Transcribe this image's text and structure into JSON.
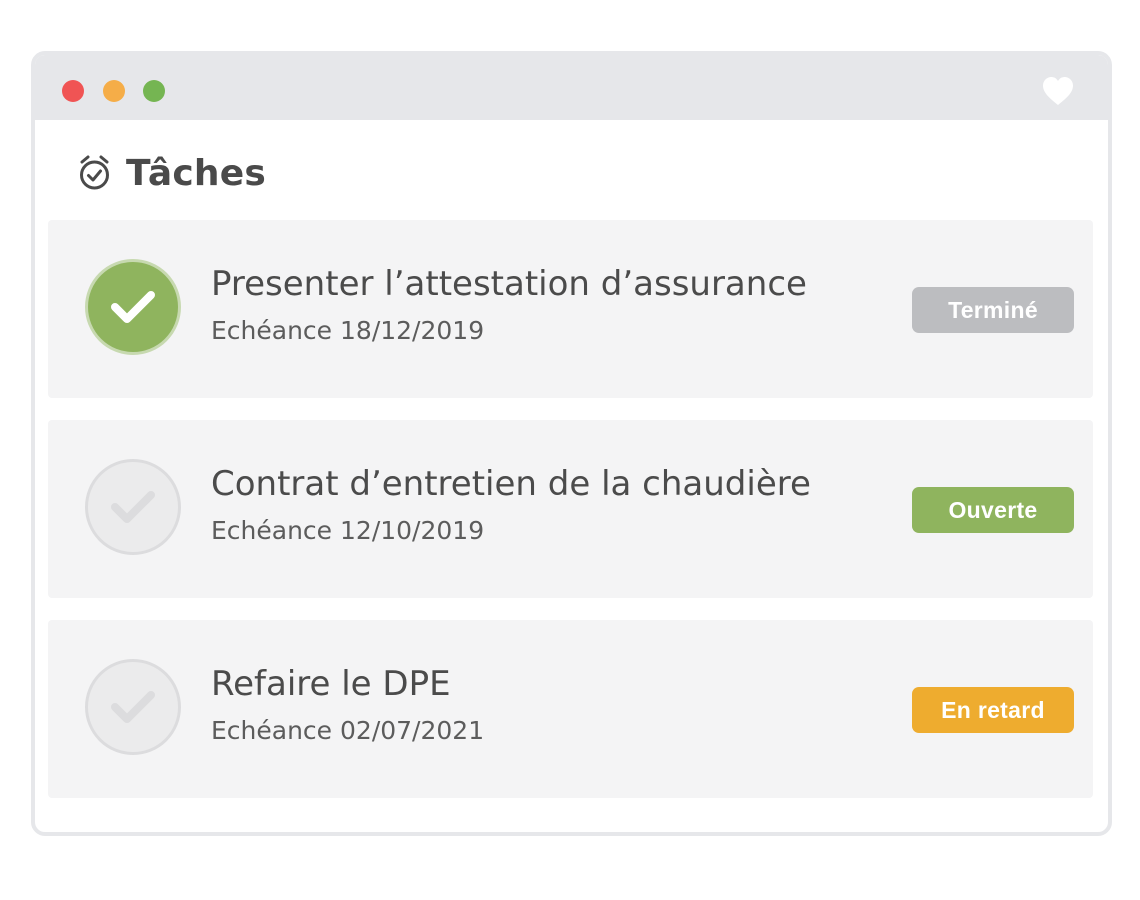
{
  "window": {
    "controls": [
      "close",
      "minimize",
      "maximize"
    ],
    "favorite_icon": "heart-icon"
  },
  "header": {
    "icon": "alarm-clock-check-icon",
    "title": "Tâches"
  },
  "tasks": [
    {
      "title": "Presenter l’attestation d’assurance",
      "due": "Echéance 18/12/2019",
      "status": "Terminé",
      "status_color": "#bcbdc0",
      "completed": true
    },
    {
      "title": "Contrat d’entretien de la chaudière",
      "due": "Echéance 12/10/2019",
      "status": "Ouverte",
      "status_color": "#8fb45e",
      "completed": false
    },
    {
      "title": "Refaire le DPE",
      "due": "Echéance 02/07/2021",
      "status": "En retard",
      "status_color": "#eeac2f",
      "completed": false
    }
  ],
  "colors": {
    "titlebar": "#e6e7ea",
    "card": "#f4f4f5",
    "done": "#8fb45e",
    "close": "#f05454",
    "minimize": "#f5ad48",
    "maximize": "#75b552"
  }
}
